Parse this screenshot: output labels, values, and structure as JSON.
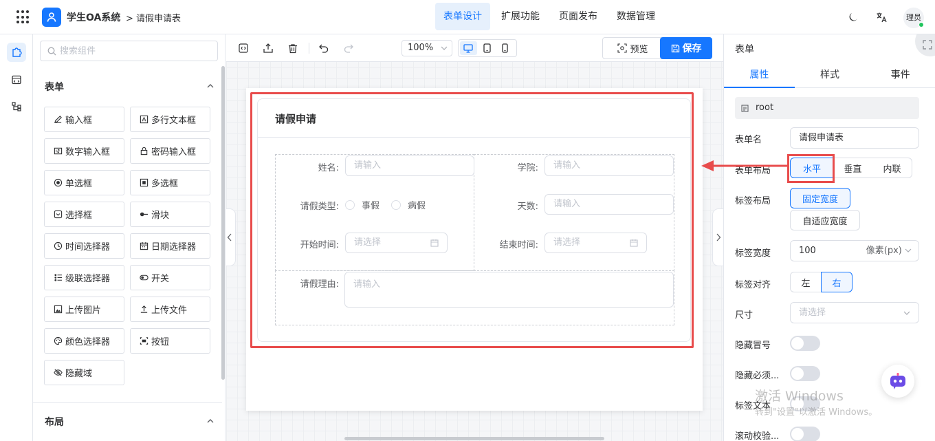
{
  "header": {
    "app_title": "学生OA系统",
    "breadcrumb": "> 请假申请表",
    "tabs": [
      {
        "label": "表单设计"
      },
      {
        "label": "扩展功能"
      },
      {
        "label": "页面发布"
      },
      {
        "label": "数据管理"
      }
    ],
    "avatar_text": "理员"
  },
  "components": {
    "search_placeholder": "搜索组件",
    "section_form": "表单",
    "section_layout": "布局",
    "items": [
      {
        "label": "输入框",
        "icon": "edit-icon"
      },
      {
        "label": "多行文本框",
        "icon": "textarea-icon"
      },
      {
        "label": "数字输入框",
        "icon": "number-icon"
      },
      {
        "label": "密码输入框",
        "icon": "lock-icon"
      },
      {
        "label": "单选框",
        "icon": "radio-icon"
      },
      {
        "label": "多选框",
        "icon": "checkbox-icon"
      },
      {
        "label": "选择框",
        "icon": "select-icon"
      },
      {
        "label": "滑块",
        "icon": "slider-icon"
      },
      {
        "label": "时间选择器",
        "icon": "clock-icon"
      },
      {
        "label": "日期选择器",
        "icon": "calendar-icon"
      },
      {
        "label": "级联选择器",
        "icon": "cascader-icon"
      },
      {
        "label": "开关",
        "icon": "switch-icon"
      },
      {
        "label": "上传图片",
        "icon": "image-icon"
      },
      {
        "label": "上传文件",
        "icon": "upload-icon"
      },
      {
        "label": "颜色选择器",
        "icon": "palette-icon"
      },
      {
        "label": "按钮",
        "icon": "button-icon"
      },
      {
        "label": "隐藏域",
        "icon": "eye-off-icon"
      }
    ]
  },
  "toolbar": {
    "zoom": "100%",
    "preview_label": "预览",
    "save_label": "保存"
  },
  "form": {
    "title": "请假申请",
    "fields": {
      "name_label": "姓名:",
      "name_placeholder": "请输入",
      "college_label": "学院:",
      "college_placeholder": "请输入",
      "leave_type_label": "请假类型:",
      "leave_type_options": [
        "事假",
        "病假"
      ],
      "days_label": "天数:",
      "days_placeholder": "请输入",
      "start_label": "开始时间:",
      "start_placeholder": "请选择",
      "end_label": "结束时间:",
      "end_placeholder": "请选择",
      "reason_label": "请假理由:",
      "reason_placeholder": "请输入"
    }
  },
  "properties": {
    "panel_title": "表单",
    "tabs": [
      "属性",
      "样式",
      "事件"
    ],
    "root_label": "root",
    "form_name_label": "表单名",
    "form_name_value": "请假申请表",
    "form_layout_label": "表单布局",
    "form_layout_options": [
      "水平",
      "垂直",
      "内联"
    ],
    "label_layout_label": "标签布局",
    "label_layout_options": [
      "固定宽度",
      "自适应宽度"
    ],
    "label_width_label": "标签宽度",
    "label_width_value": "100",
    "label_width_unit": "像素(px)",
    "label_align_label": "标签对齐",
    "label_align_options": [
      "左",
      "右"
    ],
    "size_label": "尺寸",
    "size_placeholder": "请选择",
    "hide_colon_label": "隐藏冒号",
    "hide_required_label": "隐藏必须...",
    "label_text_label": "标签文本",
    "scroll_validate_label": "滚动校验..."
  },
  "watermark": {
    "line1": "激活 Windows",
    "line2": "转到\"设置\"以激活 Windows。"
  },
  "colors": {
    "primary": "#1677ff",
    "highlight": "#e84c4c"
  }
}
